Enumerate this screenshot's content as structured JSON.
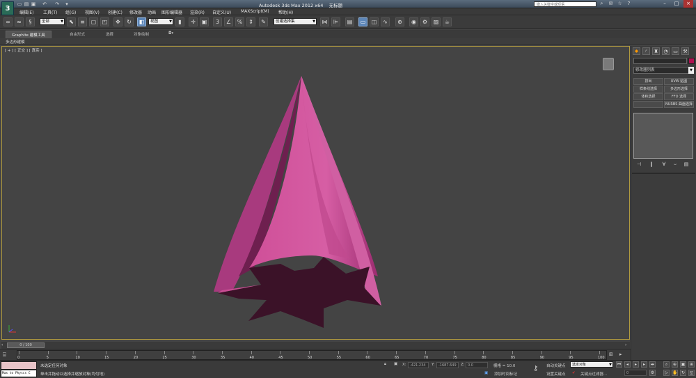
{
  "window": {
    "title": "Autodesk 3ds Max  2012 x64",
    "doc_title": "无标题",
    "help_search_placeholder": "键入关键字或短语"
  },
  "app_logo": "3",
  "menu": [
    "编辑(E)",
    "工具(T)",
    "组(G)",
    "视图(V)",
    "创建(C)",
    "修改器",
    "动画",
    "图形编辑器",
    "渲染(R)",
    "自定义(U)",
    "MAXScript(M)",
    "帮助(H)"
  ],
  "toolbar": {
    "filter_dropdown": "全部",
    "refcoord_dropdown": "视图",
    "named_selection_dropdown": "创建选择集"
  },
  "ribbon": {
    "tabs": [
      "Graphite 建模工具",
      "自由形式",
      "选择",
      "对象绘制"
    ],
    "sub_label": "多边形建模"
  },
  "viewport": {
    "label": "[ + ] [ 正交 ] [ 真实 ]"
  },
  "command_panel": {
    "modifier_list": "修改器列表",
    "buttons": [
      "挤出",
      "UVW 贴图",
      "样条线选择",
      "多边形选择",
      "体积选择",
      "FFD 选择",
      "",
      "NURBS 曲面选择"
    ]
  },
  "timeline": {
    "slider_label": "0 / 100",
    "ticks": [
      0,
      5,
      10,
      15,
      20,
      25,
      30,
      35,
      40,
      45,
      50,
      55,
      60,
      65,
      70,
      75,
      80,
      85,
      90,
      95,
      100
    ]
  },
  "status": {
    "maxscript_output": "Max to Physcs C",
    "selection_text": "未选定任何对象",
    "prompt_text": "单击并拖动以选择并缩放对象(均匀地)",
    "x_label": "X:",
    "x_value": "-421.234",
    "y_label": "Y:",
    "y_value": "-1687.649",
    "z_label": "Z:",
    "z_value": "0.0",
    "grid_text": "栅格 = 10.0",
    "add_time_tag": "添加时间标记",
    "auto_key": "自动关键点",
    "auto_key_dropdown": "选定对象",
    "set_key": "设置关键点",
    "key_filters": "关键点过滤器...",
    "frame_value": "0"
  }
}
